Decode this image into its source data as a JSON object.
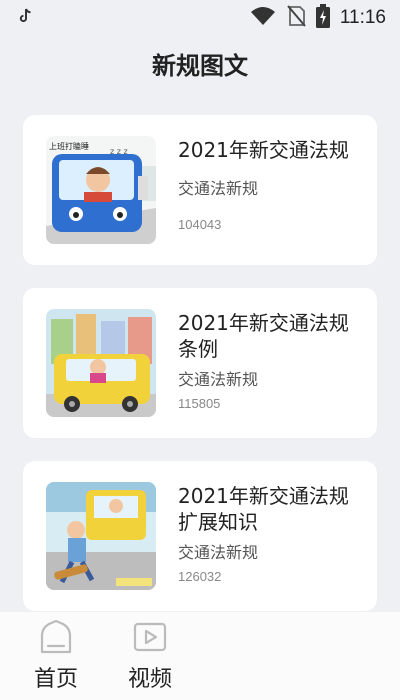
{
  "status_bar": {
    "time": "11:16",
    "icons": [
      "tiktok-icon",
      "wifi-icon",
      "no-signal-icon",
      "battery-charging-icon"
    ]
  },
  "page": {
    "title": "新规图文"
  },
  "articles": [
    {
      "title_lines": [
        "2021年新交通法规"
      ],
      "category": "交通法新规",
      "count": "104043",
      "thumbnail": "cartoon-sleepy-bus-driver"
    },
    {
      "title_lines": [
        "2021年新交通法规",
        "条例"
      ],
      "category": "交通法新规",
      "count": "115805",
      "thumbnail": "cartoon-yellow-taxi"
    },
    {
      "title_lines": [
        "2021年新交通法规",
        "扩展知识"
      ],
      "category": "交通法新规",
      "count": "126032",
      "thumbnail": "cartoon-street-crash"
    }
  ],
  "thumb_texts": {
    "bus_sign": "上班打瞌睡",
    "bus_zzz": "z z z"
  },
  "tabbar": {
    "tabs": [
      {
        "label": "首页",
        "icon": "home-icon"
      },
      {
        "label": "视频",
        "icon": "video-icon"
      }
    ]
  },
  "colors": {
    "background": "#eef0f4",
    "card": "#ffffff",
    "tabbar": "#fbfbfc"
  }
}
